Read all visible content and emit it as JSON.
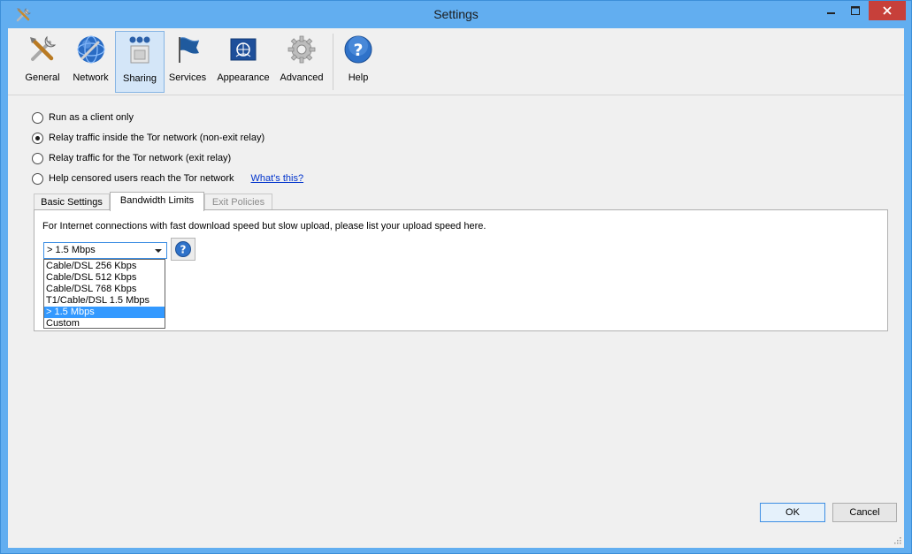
{
  "window": {
    "title": "Settings"
  },
  "toolbar": {
    "items": [
      {
        "label": "General",
        "icon": "tools-icon"
      },
      {
        "label": "Network",
        "icon": "globe-icon"
      },
      {
        "label": "Sharing",
        "icon": "sharing-icon",
        "active": true
      },
      {
        "label": "Services",
        "icon": "flag-icon"
      },
      {
        "label": "Appearance",
        "icon": "appearance-icon"
      },
      {
        "label": "Advanced",
        "icon": "gear-icon"
      },
      {
        "label": "Help",
        "icon": "help-icon"
      }
    ]
  },
  "relay_options": {
    "client_only": "Run as a client only",
    "non_exit_relay": "Relay traffic inside the Tor network (non-exit relay)",
    "exit_relay": "Relay traffic for the Tor network (exit relay)",
    "bridge": "Help censored users reach the Tor network",
    "whats_this": "What's this?",
    "selected": "non_exit_relay"
  },
  "tabs": {
    "basic": "Basic Settings",
    "bandwidth": "Bandwidth Limits",
    "exit_policies": "Exit Policies",
    "active": "bandwidth"
  },
  "bandwidth": {
    "description": "For Internet connections with fast download speed but slow upload, please list your upload speed here.",
    "selected": "> 1.5 Mbps",
    "options": [
      "Cable/DSL 256 Kbps",
      "Cable/DSL 512 Kbps",
      "Cable/DSL 768 Kbps",
      "T1/Cable/DSL 1.5 Mbps",
      "> 1.5 Mbps",
      "Custom"
    ]
  },
  "buttons": {
    "ok": "OK",
    "cancel": "Cancel"
  },
  "colors": {
    "titlebar": "#62aef0",
    "close_button": "#c7403a",
    "selection": "#3399ff",
    "link": "#0033cc"
  }
}
